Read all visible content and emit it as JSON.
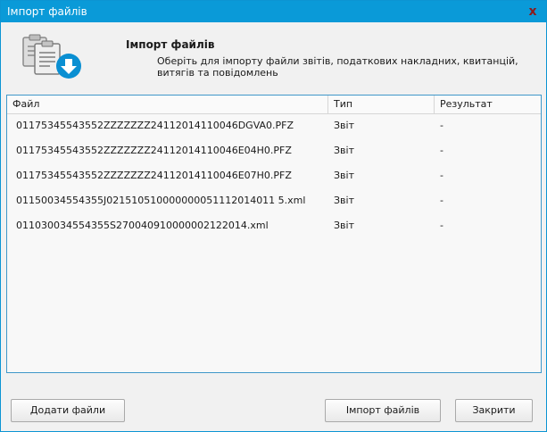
{
  "window": {
    "title": "Імпорт файлів",
    "close_glyph": "x"
  },
  "header": {
    "title": "Імпорт файлів",
    "description": "Оберіть для імпорту файли звітів, податкових накладних, квитанцій, витягів та повідомлень",
    "icon": "import-documents-icon"
  },
  "table": {
    "columns": [
      "Файл",
      "Тип",
      "Результат"
    ],
    "rows": [
      {
        "file": "01175345543552ZZZZZZZ24112014110046DGVA0.PFZ",
        "type": "Звіт",
        "result": "-"
      },
      {
        "file": "01175345543552ZZZZZZZ24112014110046E04H0.PFZ",
        "type": "Звіт",
        "result": "-"
      },
      {
        "file": "01175345543552ZZZZZZZ24112014110046E07H0.PFZ",
        "type": "Звіт",
        "result": "-"
      },
      {
        "file": "01150034554355J021510510000000051112014011 5.xml",
        "type": "Звіт",
        "result": "-"
      },
      {
        "file": "011030034554355S270040910000002122014.xml",
        "type": "Звіт",
        "result": "-"
      }
    ]
  },
  "buttons": {
    "add_files": "Додати файли",
    "import_files": "Імпорт файлів",
    "close": "Закрити"
  },
  "colors": {
    "titlebar": "#0a9ad8",
    "border": "#3f97c9",
    "accent_download": "#0a8fd2"
  }
}
